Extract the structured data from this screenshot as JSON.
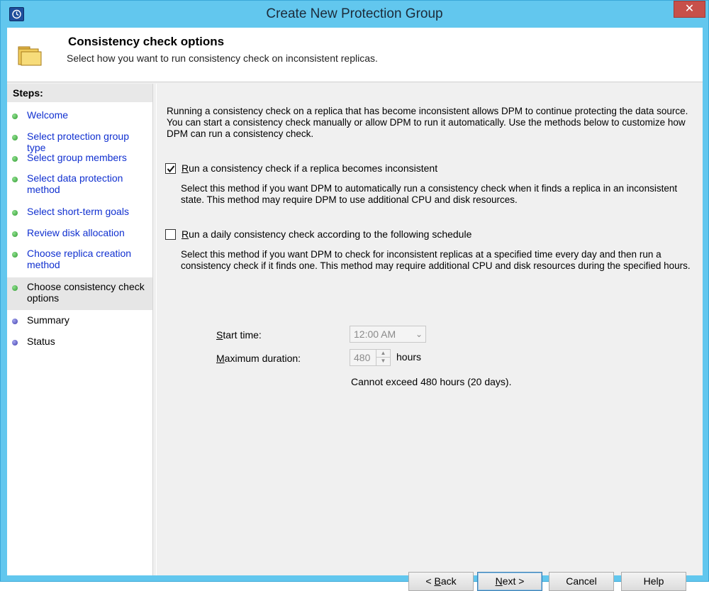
{
  "window": {
    "title": "Create New Protection Group",
    "close_glyph": "✕",
    "colors": {
      "frame": "#62c7ee",
      "close": "#c7504a",
      "link": "#1030d0"
    }
  },
  "header": {
    "title": "Consistency check options",
    "subtitle": "Select how you want to run consistency check on inconsistent replicas.",
    "icon": "folder-icon"
  },
  "steps": {
    "heading": "Steps:",
    "items": [
      {
        "label": "Welcome",
        "status": "done"
      },
      {
        "label": "Select protection group type",
        "status": "done"
      },
      {
        "label": "Select group members",
        "status": "done"
      },
      {
        "label": "Select data protection method",
        "status": "done"
      },
      {
        "label": "Select short-term goals",
        "status": "done"
      },
      {
        "label": "Review disk allocation",
        "status": "done"
      },
      {
        "label": "Choose replica creation method",
        "status": "done"
      },
      {
        "label": "Choose consistency check options",
        "status": "current"
      },
      {
        "label": "Summary",
        "status": "pending"
      },
      {
        "label": "Status",
        "status": "pending"
      }
    ]
  },
  "main": {
    "intro": "Running a consistency check on a replica that has become inconsistent allows DPM to continue protecting the data source. You can start a consistency check manually or allow DPM to run it automatically. Use the methods below to customize how DPM can run a consistency check.",
    "option1": {
      "checked": true,
      "label_accel": "R",
      "label_rest": "un a consistency check if a replica becomes inconsistent",
      "description": "Select this method if you want DPM to automatically run a consistency check when it finds a replica in an inconsistent state. This method may require DPM to use additional CPU and disk resources."
    },
    "option2": {
      "checked": false,
      "label_accel": "R",
      "label_rest": "un a daily consistency check according to the following schedule",
      "description": "Select this method if you want DPM to check for inconsistent replicas at a specified time every day and then run a consistency check if it finds one. This method may require additional CPU and disk resources during the specified hours."
    },
    "start_time": {
      "label_accel": "S",
      "label_rest": "tart time:",
      "value": "12:00 AM"
    },
    "max_duration": {
      "label_accel": "M",
      "label_rest": "aximum duration:",
      "value": "480",
      "unit": "hours"
    },
    "limit_note": "Cannot exceed 480 hours (20 days)."
  },
  "buttons": {
    "back": {
      "prefix": "< ",
      "accel": "B",
      "rest": "ack"
    },
    "next": {
      "accel": "N",
      "rest": "ext >"
    },
    "cancel": "Cancel",
    "help": "Help"
  }
}
